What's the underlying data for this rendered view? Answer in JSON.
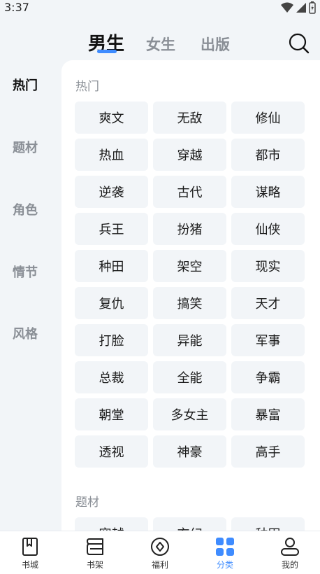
{
  "status_bar": {
    "time": "3:37"
  },
  "top_tabs": {
    "male": "男生",
    "female": "女生",
    "publish": "出版"
  },
  "sidebar": {
    "items": [
      {
        "label": "热门"
      },
      {
        "label": "题材"
      },
      {
        "label": "角色"
      },
      {
        "label": "情节"
      },
      {
        "label": "风格"
      }
    ]
  },
  "sections": {
    "hot": {
      "title": "热门",
      "tags": [
        "爽文",
        "无敌",
        "修仙",
        "热血",
        "穿越",
        "都市",
        "逆袭",
        "古代",
        "谋略",
        "兵王",
        "扮猪",
        "仙侠",
        "种田",
        "架空",
        "现实",
        "复仇",
        "搞笑",
        "天才",
        "打脸",
        "异能",
        "军事",
        "总裁",
        "全能",
        "争霸",
        "朝堂",
        "多女主",
        "暴富",
        "透视",
        "神豪",
        "高手"
      ]
    },
    "theme": {
      "title": "题材",
      "tags": [
        "穿越",
        "玄幻",
        "种田"
      ]
    }
  },
  "bottom_nav": {
    "items": [
      {
        "label": "书城"
      },
      {
        "label": "书架"
      },
      {
        "label": "福利"
      },
      {
        "label": "分类"
      },
      {
        "label": "我的"
      }
    ]
  },
  "colors": {
    "accent": "#3f8cff",
    "tag_bg": "#f2f5f8",
    "muted": "#8a8f96"
  }
}
